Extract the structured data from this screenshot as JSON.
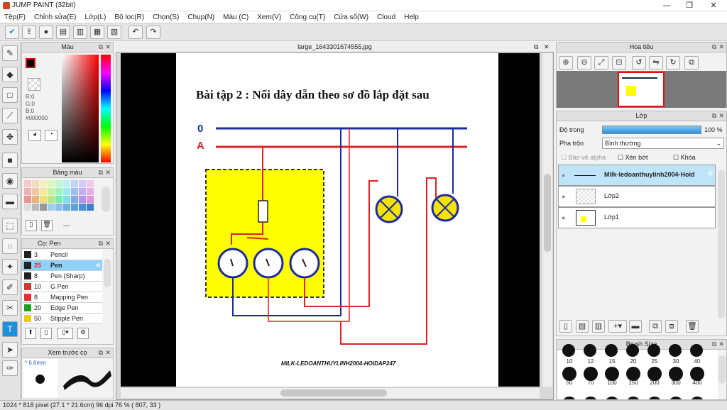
{
  "window": {
    "title": "JUMP PAINT (32bit)",
    "min": "—",
    "max": "❐",
    "close": "✕"
  },
  "menu": [
    "Tệp(F)",
    "Chỉnh sửa(E)",
    "Lớp(L)",
    "Bộ lọc(R)",
    "Chọn(S)",
    "Chụp(N)",
    "Màu (C)",
    "Xem(V)",
    "Công cụ(T)",
    "Cửa sổ(W)",
    "Cloud",
    "Help"
  ],
  "color_panel": {
    "title": "Màu",
    "r": "R:0",
    "g": "G:0",
    "b": "B:0",
    "hex": "#000000"
  },
  "palette_panel": {
    "title": "Bảng màu",
    "dash": "---"
  },
  "brush_panel": {
    "title": "Cọ: Pen",
    "items": [
      {
        "size": "3",
        "name": "Pencil",
        "color": "#222222"
      },
      {
        "size": "25",
        "name": "Pen",
        "color": "#222222"
      },
      {
        "size": "8",
        "name": "Pen (Sharp)",
        "color": "#222222"
      },
      {
        "size": "10",
        "name": "G Pen",
        "color": "#e03030"
      },
      {
        "size": "8",
        "name": "Mapping Pen",
        "color": "#e03030"
      },
      {
        "size": "20",
        "name": "Edge Pen",
        "color": "#20a020"
      },
      {
        "size": "50",
        "name": "Stipple Pen",
        "color": "#e8d000"
      }
    ]
  },
  "preview_panel": {
    "title": "Xem trước cọ",
    "size": "* 6.6mm"
  },
  "canvas": {
    "tab": "large_1643301674555.jpg",
    "heading": "Bài tập 2 : Nối dây dẫn theo sơ đồ lắp đặt sau",
    "label0": "0",
    "labelA": "A",
    "watermark": "MILK-LEDOANTHUYLINH2004-HOIDAP247"
  },
  "navigator_panel": {
    "title": "Hoa tiêu"
  },
  "layer_panel": {
    "title": "Lớp",
    "opacity_label": "Độ trong",
    "opacity_value": "100 %",
    "opacity_fraction": 1.0,
    "blend_label": "Pha trộn",
    "blend_value": "Bình thường",
    "protect_alpha": "Bảo vệ alpha",
    "clip": "Xén bớt",
    "lock": "Khóa",
    "layers": [
      {
        "name": "Milk-ledoanthuylinh2004-Hoid",
        "selected": true
      },
      {
        "name": "Lớp2",
        "selected": false
      },
      {
        "name": "Lớp1",
        "selected": false
      }
    ]
  },
  "brushsize_panel": {
    "title": "Brush Size",
    "rows": [
      [
        "10",
        "12",
        "15",
        "20",
        "25",
        "30",
        "40"
      ],
      [
        "50",
        "70",
        "100",
        "150",
        "200",
        "300",
        "400"
      ]
    ]
  },
  "status": {
    "text": "1024 * 818 pixel   (27.1 * 21.6cm)   96 dpi   76 %   ( 807, 33 )"
  }
}
